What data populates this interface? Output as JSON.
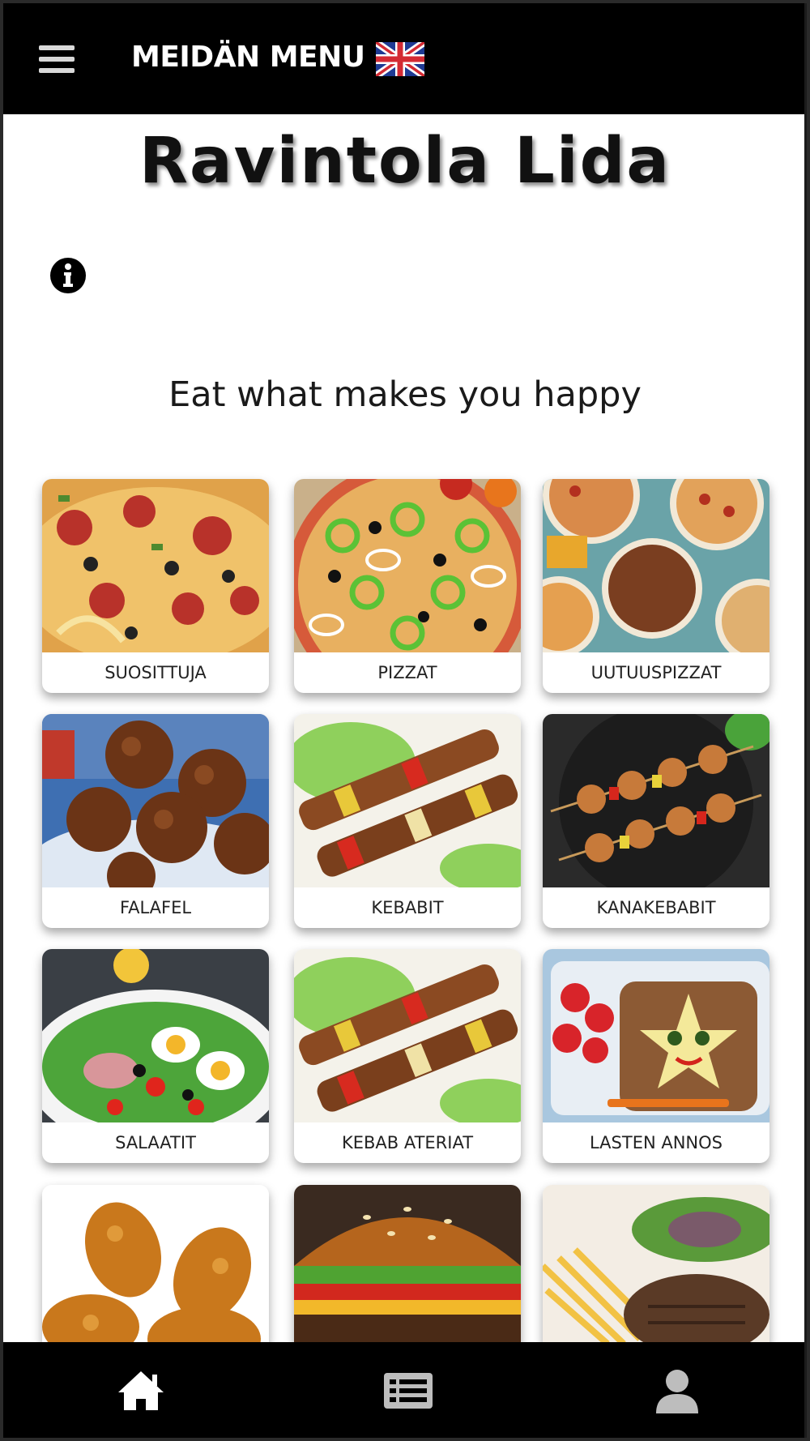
{
  "header": {
    "brand": "MEIDÄN MENU",
    "menu_icon": "hamburger-icon",
    "language_icon": "uk-flag-icon"
  },
  "restaurant_name": "Ravintola Lida",
  "info_icon": "info-icon",
  "tagline": "Eat what makes you happy",
  "categories": [
    {
      "label": "SUOSITTUJA",
      "image": "pizza-closeup"
    },
    {
      "label": "PIZZAT",
      "image": "pizza-peppers"
    },
    {
      "label": "UUTUUSPIZZAT",
      "image": "pizza-assortment"
    },
    {
      "label": "FALAFEL",
      "image": "falafel"
    },
    {
      "label": "KEBABIT",
      "image": "kebab-skewers"
    },
    {
      "label": "KANAKEBABIT",
      "image": "chicken-skewers"
    },
    {
      "label": "SALAATIT",
      "image": "salad"
    },
    {
      "label": "KEBAB ATERIAT",
      "image": "kebab-skewers"
    },
    {
      "label": "LASTEN ANNOS",
      "image": "kids-meal"
    },
    {
      "label": "",
      "image": "fried-chicken"
    },
    {
      "label": "",
      "image": "burger"
    },
    {
      "label": "",
      "image": "steak-fries"
    }
  ],
  "bottom_nav": [
    {
      "icon": "home-icon",
      "color": "#ffffff"
    },
    {
      "icon": "menu-list-icon",
      "color": "#bdbdbd"
    },
    {
      "icon": "user-icon",
      "color": "#bdbdbd"
    }
  ],
  "colors": {
    "bar": "#000000",
    "accent": "#ffffff",
    "label_text": "#222222"
  }
}
